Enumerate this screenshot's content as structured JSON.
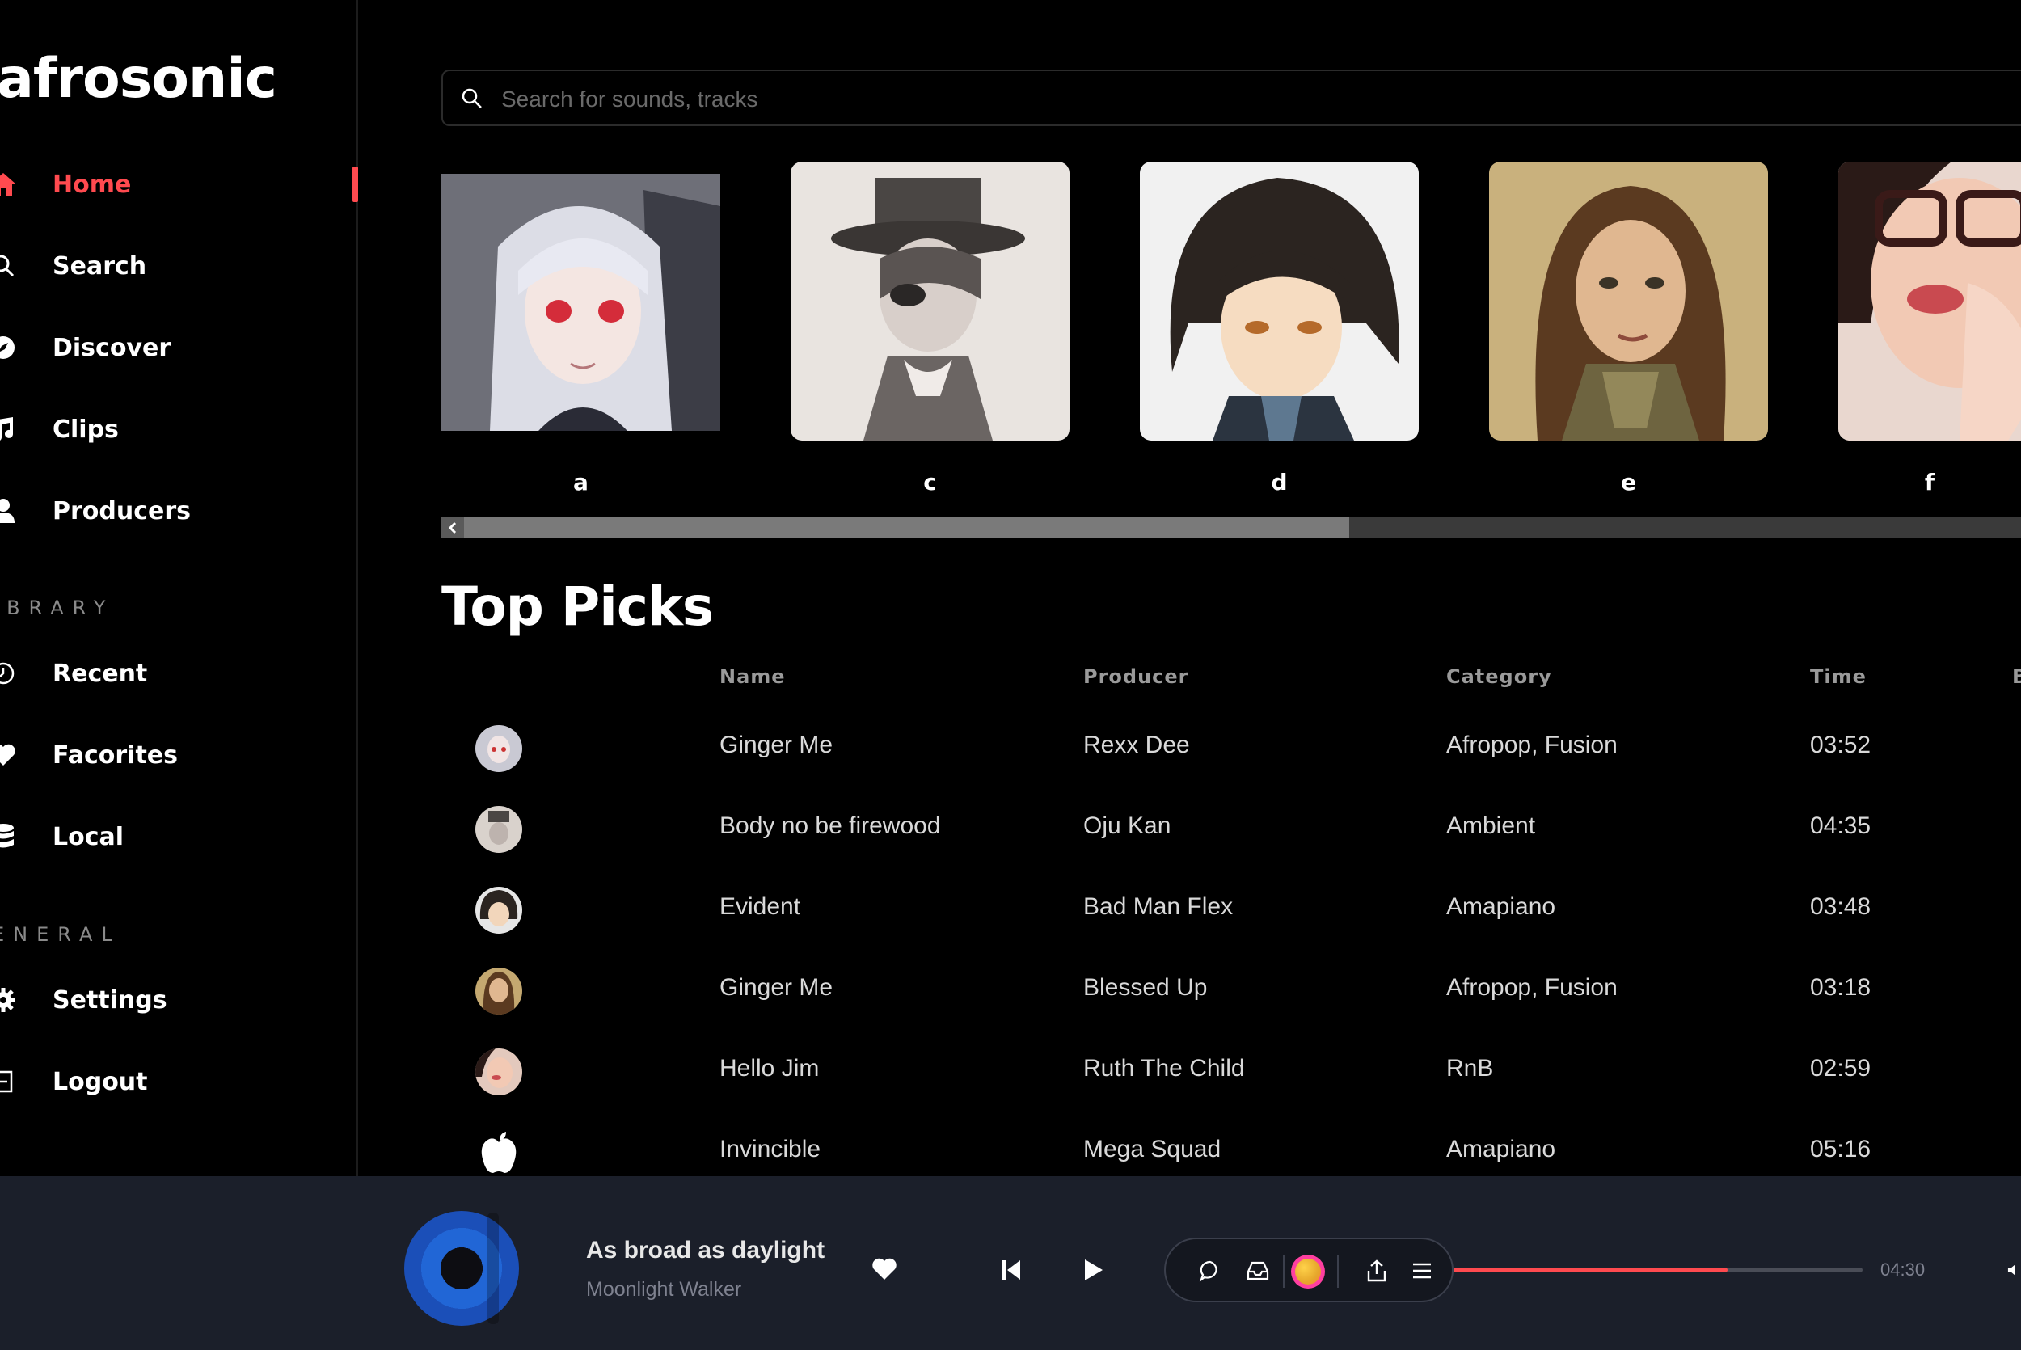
{
  "app": {
    "logo": "afrosonic"
  },
  "sidebar": {
    "nav": [
      {
        "label": "Home",
        "icon": "home-icon",
        "active": true
      },
      {
        "label": "Search",
        "icon": "search-icon"
      },
      {
        "label": "Discover",
        "icon": "compass-icon"
      },
      {
        "label": "Clips",
        "icon": "music-note-icon"
      },
      {
        "label": "Producers",
        "icon": "user-icon"
      }
    ],
    "library_label": "IBRARY",
    "library": [
      {
        "label": "Recent",
        "icon": "clock-icon"
      },
      {
        "label": "Facorites",
        "icon": "heart-icon"
      },
      {
        "label": "Local",
        "icon": "database-icon"
      }
    ],
    "general_label": "ENERAL",
    "general": [
      {
        "label": "Settings",
        "icon": "gear-icon"
      },
      {
        "label": "Logout",
        "icon": "logout-icon"
      }
    ]
  },
  "search": {
    "placeholder": "Search for sounds, tracks"
  },
  "artists": [
    {
      "name": "a"
    },
    {
      "name": "c"
    },
    {
      "name": "d"
    },
    {
      "name": "e"
    },
    {
      "name": "f"
    }
  ],
  "top_picks": {
    "title": "Top Picks",
    "columns": [
      "Name",
      "Producer",
      "Category",
      "Time",
      "B"
    ],
    "rows": [
      {
        "name": "Ginger Me",
        "producer": "Rexx Dee",
        "category": "Afropop, Fusion",
        "time": "03:52"
      },
      {
        "name": "Body no be firewood",
        "producer": "Oju Kan",
        "category": "Ambient",
        "time": "04:35"
      },
      {
        "name": "Evident",
        "producer": "Bad Man Flex",
        "category": "Amapiano",
        "time": "03:48"
      },
      {
        "name": "Ginger Me",
        "producer": "Blessed Up",
        "category": "Afropop, Fusion",
        "time": "03:18"
      },
      {
        "name": "Hello Jim",
        "producer": "Ruth The Child",
        "category": "RnB",
        "time": "02:59"
      },
      {
        "name": "Invincible",
        "producer": "Mega Squad",
        "category": "Amapiano",
        "time": "05:16"
      }
    ]
  },
  "player": {
    "title": "As broad as daylight",
    "artist": "Moonlight Walker",
    "duration": "04:30",
    "progress": 0.67
  },
  "colors": {
    "accent": "#ff4a4f",
    "player_bg": "#1b1f2a"
  }
}
